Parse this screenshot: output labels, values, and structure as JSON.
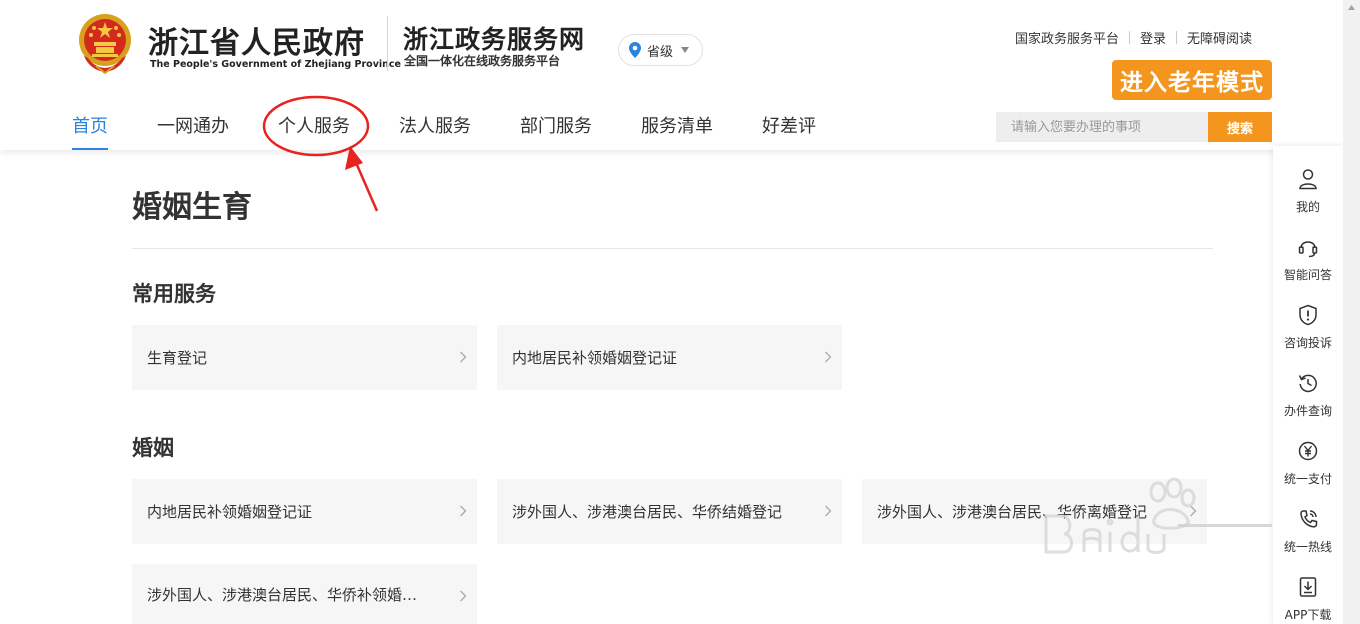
{
  "header": {
    "gov_name_cn": "浙江省人民政府",
    "gov_name_en": "The People's Government of Zhejiang Province",
    "site_name": "浙江政务服务网",
    "site_subtitle": "全国一体化在线政务服务平台",
    "location_label": "省级",
    "top_links": [
      "国家政务服务平台",
      "登录",
      "无障碍阅读"
    ],
    "elder_mode_label": "进入老年模式",
    "search_placeholder": "请输入您要办理的事项",
    "search_button_label": "搜索"
  },
  "nav": [
    {
      "label": "首页",
      "active": true
    },
    {
      "label": "一网通办",
      "active": false
    },
    {
      "label": "个人服务",
      "active": false
    },
    {
      "label": "法人服务",
      "active": false
    },
    {
      "label": "部门服务",
      "active": false
    },
    {
      "label": "服务清单",
      "active": false
    },
    {
      "label": "好差评",
      "active": false
    }
  ],
  "main": {
    "page_title": "婚姻生育",
    "sections": [
      {
        "title": "常用服务",
        "items": [
          "生育登记",
          "内地居民补领婚姻登记证"
        ]
      },
      {
        "title": "婚姻",
        "items": [
          "内地居民补领婚姻登记证",
          "涉外国人、涉港澳台居民、华侨结婚登记",
          "涉外国人、涉港澳台居民、华侨离婚登记",
          "涉外国人、涉港澳台居民、华侨补领婚姻登记证"
        ]
      }
    ]
  },
  "sidebar": [
    {
      "label": "我的",
      "icon": "user-icon"
    },
    {
      "label": "智能问答",
      "icon": "headset-icon"
    },
    {
      "label": "咨询投诉",
      "icon": "alert-shield-icon"
    },
    {
      "label": "办件查询",
      "icon": "history-icon"
    },
    {
      "label": "统一支付",
      "icon": "yuan-icon"
    },
    {
      "label": "统一热线",
      "icon": "phone-icon"
    },
    {
      "label": "APP下载",
      "icon": "download-icon"
    }
  ],
  "colors": {
    "accent_blue": "#2a84e0",
    "accent_orange": "#f4961e",
    "annotation_red": "#e8231f"
  }
}
